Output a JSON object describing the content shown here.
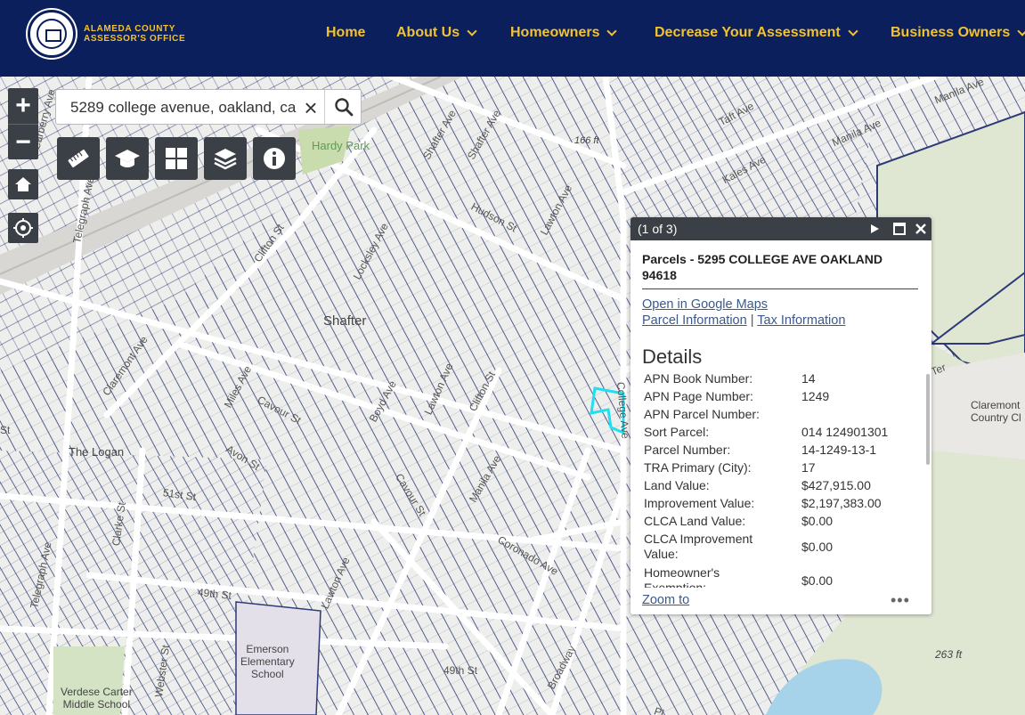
{
  "header": {
    "logo_line1": "ALAMEDA COUNTY",
    "logo_line2": "ASSESSOR'S OFFICE",
    "nav": [
      {
        "label": "Home",
        "dropdown": false
      },
      {
        "label": "About Us",
        "dropdown": true
      },
      {
        "label": "Homeowners",
        "dropdown": true
      },
      {
        "label": "Decrease Your Assessment",
        "dropdown": true
      },
      {
        "label": "Business Owners",
        "dropdown": true
      }
    ],
    "colors": {
      "bg": "#0b1f5c",
      "accent": "#f2c230"
    }
  },
  "search": {
    "value": "5289 college avenue, oakland, ca"
  },
  "toolbar": {
    "icons": [
      "measure-icon",
      "education-icon",
      "basemap-grid-icon",
      "layers-icon",
      "info-icon"
    ]
  },
  "map": {
    "streets": {
      "telegraph_ave": "Telegraph Ave",
      "telegraph_ave_2": "Telegraph Ave",
      "carberry_ave": "Carberry Ave",
      "claremont_ave": "Claremont Ave",
      "clifton_st": "Clifton St",
      "clifton_st_2": "Clifton St",
      "miles_ave": "Miles Ave",
      "cavour_st": "Cavour St",
      "cavour_st_2": "Cavour St",
      "avon_st": "Avon St",
      "st_51": "51st St",
      "st_49": "49th St",
      "st_49_2": "49th St",
      "clarke_st": "Clarke St",
      "webster_st": "Webster St",
      "lawton_ave": "Lawton Ave",
      "lawton_ave_2": "Lawton Ave",
      "lawton_ave_3": "Lawton Ave",
      "hudson_st": "Hudson St",
      "shafter_ave": "Shafter Ave",
      "locksley_ave": "Locksley Ave",
      "boyd_ave": "Boyd Ave",
      "manila_ave": "Manila Ave",
      "manila_ave_2": "Manila Ave",
      "coronado_ave": "Coronado Ave",
      "broadway": "Broadway",
      "taft_ave": "Taft Ave",
      "kales_ave": "Kales Ave",
      "college_ave": "College Ave",
      "fr_ave": "Ave",
      "ter": "Ter",
      "st_frag": "St",
      "pl_frag": "Pl"
    },
    "places": {
      "hardy_park": "Hardy Park",
      "shafter": "Shafter",
      "the_logan": "The Logan",
      "emerson": "Emerson\nElementary\nSchool",
      "verdese": "Verdese Carter\nMiddle School",
      "claremont_cc": "Claremont\nCountry Cl",
      "elev_1": "263 ft",
      "elev_2": "263 ft",
      "elev_3": "166 ft"
    }
  },
  "popup": {
    "pager": "(1 of 3)",
    "title": "Parcels - 5295 COLLEGE AVE OAKLAND 94618",
    "link_maps": "Open in Google Maps",
    "link_parcel": "Parcel Information",
    "link_sep": "|",
    "link_tax": "Tax Information",
    "details_heading": "Details",
    "fields": [
      {
        "k": "APN Book Number:",
        "v": "14"
      },
      {
        "k": "APN Page Number:",
        "v": "1249"
      },
      {
        "k": "APN Parcel Number:",
        "v": ""
      },
      {
        "k": "Sort Parcel:",
        "v": "014 124901301"
      },
      {
        "k": "Parcel Number:",
        "v": "14-1249-13-1"
      },
      {
        "k": "TRA Primary (City):",
        "v": "17"
      },
      {
        "k": "Land Value:",
        "v": "$427,915.00"
      },
      {
        "k": "Improvement Value:",
        "v": "$2,197,383.00"
      },
      {
        "k": "CLCA Land Value:",
        "v": "$0.00"
      },
      {
        "k": "CLCA Improvement Value:",
        "v": "$0.00"
      },
      {
        "k": "Homeowner's Exemption:",
        "v": "$0.00"
      }
    ],
    "zoom_to": "Zoom to",
    "more": "•••"
  }
}
